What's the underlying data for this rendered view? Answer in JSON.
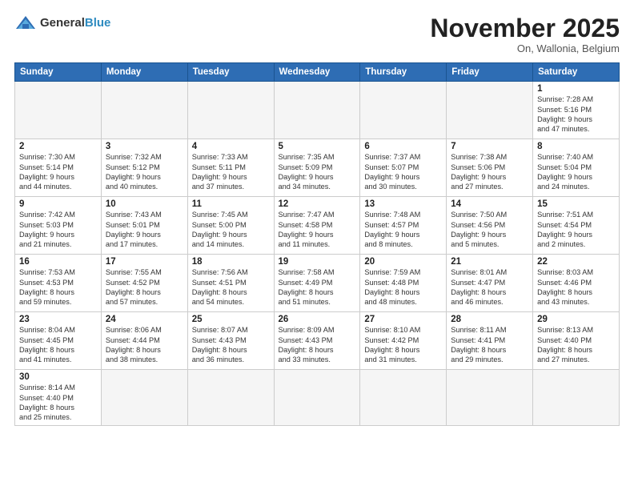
{
  "logo": {
    "text_general": "General",
    "text_blue": "Blue"
  },
  "header": {
    "month": "November 2025",
    "location": "On, Wallonia, Belgium"
  },
  "weekdays": [
    "Sunday",
    "Monday",
    "Tuesday",
    "Wednesday",
    "Thursday",
    "Friday",
    "Saturday"
  ],
  "weeks": [
    [
      {
        "day": "",
        "info": ""
      },
      {
        "day": "",
        "info": ""
      },
      {
        "day": "",
        "info": ""
      },
      {
        "day": "",
        "info": ""
      },
      {
        "day": "",
        "info": ""
      },
      {
        "day": "",
        "info": ""
      },
      {
        "day": "1",
        "info": "Sunrise: 7:28 AM\nSunset: 5:16 PM\nDaylight: 9 hours\nand 47 minutes."
      }
    ],
    [
      {
        "day": "2",
        "info": "Sunrise: 7:30 AM\nSunset: 5:14 PM\nDaylight: 9 hours\nand 44 minutes."
      },
      {
        "day": "3",
        "info": "Sunrise: 7:32 AM\nSunset: 5:12 PM\nDaylight: 9 hours\nand 40 minutes."
      },
      {
        "day": "4",
        "info": "Sunrise: 7:33 AM\nSunset: 5:11 PM\nDaylight: 9 hours\nand 37 minutes."
      },
      {
        "day": "5",
        "info": "Sunrise: 7:35 AM\nSunset: 5:09 PM\nDaylight: 9 hours\nand 34 minutes."
      },
      {
        "day": "6",
        "info": "Sunrise: 7:37 AM\nSunset: 5:07 PM\nDaylight: 9 hours\nand 30 minutes."
      },
      {
        "day": "7",
        "info": "Sunrise: 7:38 AM\nSunset: 5:06 PM\nDaylight: 9 hours\nand 27 minutes."
      },
      {
        "day": "8",
        "info": "Sunrise: 7:40 AM\nSunset: 5:04 PM\nDaylight: 9 hours\nand 24 minutes."
      }
    ],
    [
      {
        "day": "9",
        "info": "Sunrise: 7:42 AM\nSunset: 5:03 PM\nDaylight: 9 hours\nand 21 minutes."
      },
      {
        "day": "10",
        "info": "Sunrise: 7:43 AM\nSunset: 5:01 PM\nDaylight: 9 hours\nand 17 minutes."
      },
      {
        "day": "11",
        "info": "Sunrise: 7:45 AM\nSunset: 5:00 PM\nDaylight: 9 hours\nand 14 minutes."
      },
      {
        "day": "12",
        "info": "Sunrise: 7:47 AM\nSunset: 4:58 PM\nDaylight: 9 hours\nand 11 minutes."
      },
      {
        "day": "13",
        "info": "Sunrise: 7:48 AM\nSunset: 4:57 PM\nDaylight: 9 hours\nand 8 minutes."
      },
      {
        "day": "14",
        "info": "Sunrise: 7:50 AM\nSunset: 4:56 PM\nDaylight: 9 hours\nand 5 minutes."
      },
      {
        "day": "15",
        "info": "Sunrise: 7:51 AM\nSunset: 4:54 PM\nDaylight: 9 hours\nand 2 minutes."
      }
    ],
    [
      {
        "day": "16",
        "info": "Sunrise: 7:53 AM\nSunset: 4:53 PM\nDaylight: 8 hours\nand 59 minutes."
      },
      {
        "day": "17",
        "info": "Sunrise: 7:55 AM\nSunset: 4:52 PM\nDaylight: 8 hours\nand 57 minutes."
      },
      {
        "day": "18",
        "info": "Sunrise: 7:56 AM\nSunset: 4:51 PM\nDaylight: 8 hours\nand 54 minutes."
      },
      {
        "day": "19",
        "info": "Sunrise: 7:58 AM\nSunset: 4:49 PM\nDaylight: 8 hours\nand 51 minutes."
      },
      {
        "day": "20",
        "info": "Sunrise: 7:59 AM\nSunset: 4:48 PM\nDaylight: 8 hours\nand 48 minutes."
      },
      {
        "day": "21",
        "info": "Sunrise: 8:01 AM\nSunset: 4:47 PM\nDaylight: 8 hours\nand 46 minutes."
      },
      {
        "day": "22",
        "info": "Sunrise: 8:03 AM\nSunset: 4:46 PM\nDaylight: 8 hours\nand 43 minutes."
      }
    ],
    [
      {
        "day": "23",
        "info": "Sunrise: 8:04 AM\nSunset: 4:45 PM\nDaylight: 8 hours\nand 41 minutes."
      },
      {
        "day": "24",
        "info": "Sunrise: 8:06 AM\nSunset: 4:44 PM\nDaylight: 8 hours\nand 38 minutes."
      },
      {
        "day": "25",
        "info": "Sunrise: 8:07 AM\nSunset: 4:43 PM\nDaylight: 8 hours\nand 36 minutes."
      },
      {
        "day": "26",
        "info": "Sunrise: 8:09 AM\nSunset: 4:43 PM\nDaylight: 8 hours\nand 33 minutes."
      },
      {
        "day": "27",
        "info": "Sunrise: 8:10 AM\nSunset: 4:42 PM\nDaylight: 8 hours\nand 31 minutes."
      },
      {
        "day": "28",
        "info": "Sunrise: 8:11 AM\nSunset: 4:41 PM\nDaylight: 8 hours\nand 29 minutes."
      },
      {
        "day": "29",
        "info": "Sunrise: 8:13 AM\nSunset: 4:40 PM\nDaylight: 8 hours\nand 27 minutes."
      }
    ],
    [
      {
        "day": "30",
        "info": "Sunrise: 8:14 AM\nSunset: 4:40 PM\nDaylight: 8 hours\nand 25 minutes."
      },
      {
        "day": "",
        "info": ""
      },
      {
        "day": "",
        "info": ""
      },
      {
        "day": "",
        "info": ""
      },
      {
        "day": "",
        "info": ""
      },
      {
        "day": "",
        "info": ""
      },
      {
        "day": "",
        "info": ""
      }
    ]
  ]
}
